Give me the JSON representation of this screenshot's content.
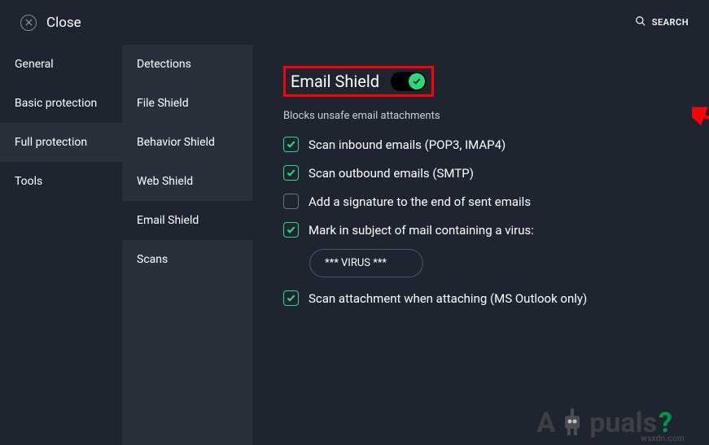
{
  "header": {
    "close_label": "Close",
    "search_label": "SEARCH"
  },
  "sidebar": {
    "items": [
      {
        "label": "General"
      },
      {
        "label": "Basic protection"
      },
      {
        "label": "Full protection"
      },
      {
        "label": "Tools"
      }
    ],
    "active_index": 2
  },
  "subnav": {
    "items": [
      {
        "label": "Detections"
      },
      {
        "label": "File Shield"
      },
      {
        "label": "Behavior Shield"
      },
      {
        "label": "Web Shield"
      },
      {
        "label": "Email Shield"
      },
      {
        "label": "Scans"
      }
    ],
    "active_index": 4
  },
  "main": {
    "title": "Email Shield",
    "toggle_on": true,
    "subtitle": "Blocks unsafe email attachments",
    "options": [
      {
        "checked": true,
        "label": "Scan inbound emails (POP3, IMAP4)"
      },
      {
        "checked": true,
        "label": "Scan outbound emails (SMTP)"
      },
      {
        "checked": false,
        "label": "Add a signature to the end of sent emails"
      },
      {
        "checked": true,
        "label": "Mark in subject of mail containing a virus:"
      },
      {
        "checked": true,
        "label": "Scan attachment when attaching (MS Outlook only)"
      }
    ],
    "virus_tag": "*** VIRUS ***"
  },
  "watermark": {
    "text_left": "A",
    "text_right": "puals",
    "question": "?",
    "footer": "wsxdn.com"
  }
}
